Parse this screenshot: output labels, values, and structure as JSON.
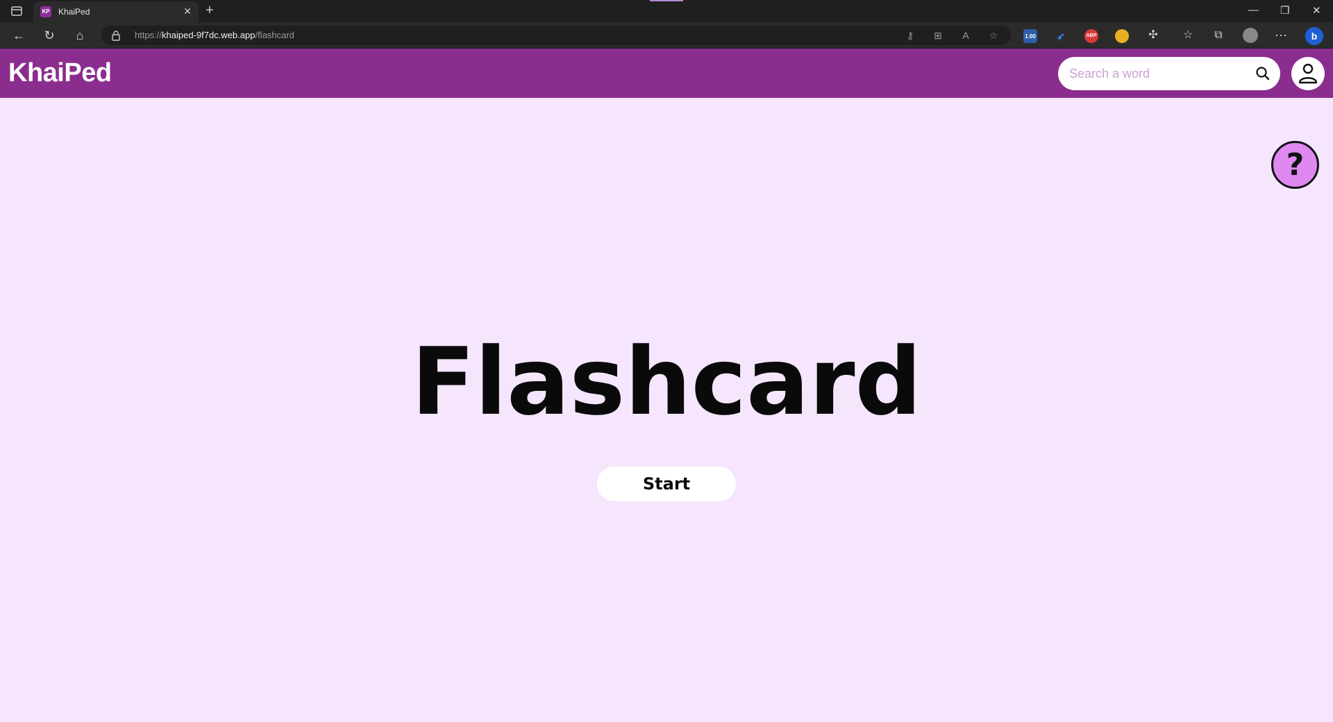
{
  "browser": {
    "tab_title": "KhaiPed",
    "favicon_text": "KP",
    "url_scheme": "https://",
    "url_host": "khaiped-9f7dc.web.app",
    "url_path": "/flashcard",
    "extension_badge": "1.00",
    "abp_label": "ABP"
  },
  "header": {
    "logo": "KhaiPed",
    "search_placeholder": "Search a word",
    "colors": {
      "header_bg": "#8b2d8e",
      "page_bg": "#f5e6fe",
      "help_bg": "#de88f0"
    }
  },
  "main": {
    "title": "Flashcard",
    "start_label": "Start",
    "help_label": "?"
  },
  "icons": [
    "sidebar-icon",
    "close-icon",
    "plus-icon",
    "minimize-icon",
    "restore-icon",
    "back-icon",
    "refresh-icon",
    "home-icon",
    "lock-icon",
    "key-icon",
    "grid-icon",
    "read-aloud-icon",
    "star-icon",
    "puzzle-icon",
    "favorites-icon",
    "collections-icon",
    "avatar-icon",
    "more-icon",
    "bing-icon",
    "search-icon",
    "user-icon",
    "help-icon"
  ]
}
